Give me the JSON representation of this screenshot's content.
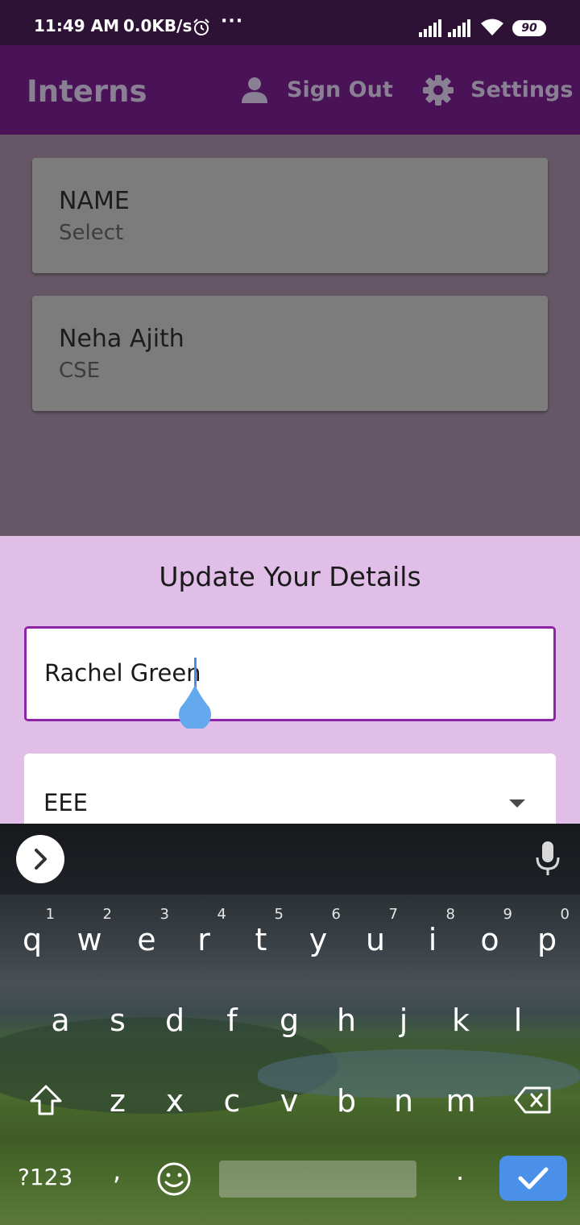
{
  "status": {
    "time": "11:49 AM",
    "speed": "0.0KB/s",
    "more": "···",
    "battery": "90"
  },
  "appbar": {
    "title": "Interns",
    "sign_out": "Sign Out",
    "settings": "Settings"
  },
  "list": [
    {
      "title": "NAME",
      "subtitle": "Select"
    },
    {
      "title": "Neha Ajith",
      "subtitle": "CSE"
    }
  ],
  "sheet": {
    "title": "Update Your Details",
    "name_value": "Rachel Green",
    "department_value": "EEE"
  },
  "keyboard": {
    "row1": [
      {
        "ch": "q",
        "hint": "1"
      },
      {
        "ch": "w",
        "hint": "2"
      },
      {
        "ch": "e",
        "hint": "3"
      },
      {
        "ch": "r",
        "hint": "4"
      },
      {
        "ch": "t",
        "hint": "5"
      },
      {
        "ch": "y",
        "hint": "6"
      },
      {
        "ch": "u",
        "hint": "7"
      },
      {
        "ch": "i",
        "hint": "8"
      },
      {
        "ch": "o",
        "hint": "9"
      },
      {
        "ch": "p",
        "hint": "0"
      }
    ],
    "row2": [
      "a",
      "s",
      "d",
      "f",
      "g",
      "h",
      "j",
      "k",
      "l"
    ],
    "row3": [
      "z",
      "x",
      "c",
      "v",
      "b",
      "n",
      "m"
    ],
    "symbols": "?123",
    "comma": ",",
    "period": "."
  },
  "colors": {
    "statusbar": "#2e1236",
    "appbar": "#4a1358",
    "scrim_list": "#655765",
    "sheet": "#e1bee7",
    "input_border": "#8e24aa",
    "enter_key": "#4a8fe8"
  }
}
